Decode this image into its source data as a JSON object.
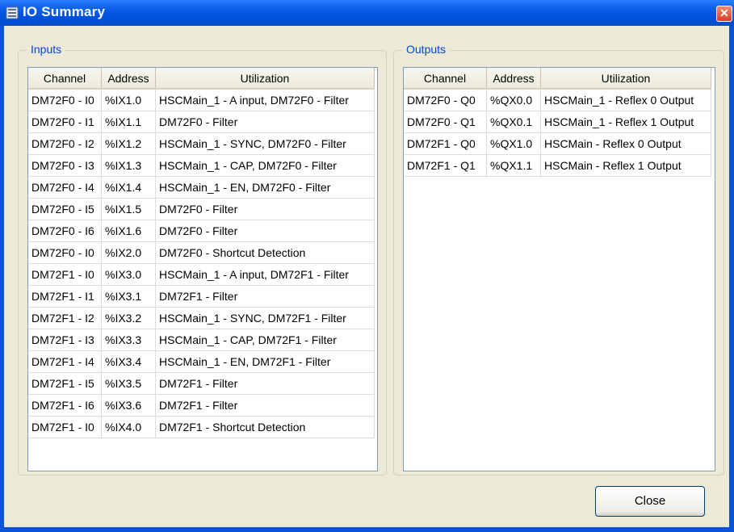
{
  "window": {
    "title": "IO Summary",
    "close_glyph": "✕"
  },
  "columns": {
    "channel": "Channel",
    "address": "Address",
    "utilization": "Utilization"
  },
  "inputs": {
    "legend": "Inputs",
    "rows": [
      {
        "channel": "DM72F0 - I0",
        "address": "%IX1.0",
        "utilization": "HSCMain_1 - A input, DM72F0 - Filter"
      },
      {
        "channel": "DM72F0 - I1",
        "address": "%IX1.1",
        "utilization": "DM72F0 - Filter"
      },
      {
        "channel": "DM72F0 - I2",
        "address": "%IX1.2",
        "utilization": "HSCMain_1 - SYNC, DM72F0 - Filter"
      },
      {
        "channel": "DM72F0 - I3",
        "address": "%IX1.3",
        "utilization": "HSCMain_1 - CAP, DM72F0 - Filter"
      },
      {
        "channel": "DM72F0 - I4",
        "address": "%IX1.4",
        "utilization": "HSCMain_1 - EN, DM72F0 - Filter"
      },
      {
        "channel": "DM72F0 - I5",
        "address": "%IX1.5",
        "utilization": "DM72F0 - Filter"
      },
      {
        "channel": "DM72F0 - I6",
        "address": "%IX1.6",
        "utilization": "DM72F0 - Filter"
      },
      {
        "channel": "DM72F0 - I0",
        "address": "%IX2.0",
        "utilization": "DM72F0 - Shortcut Detection"
      },
      {
        "channel": "DM72F1 - I0",
        "address": "%IX3.0",
        "utilization": "HSCMain_1 - A input, DM72F1 - Filter"
      },
      {
        "channel": "DM72F1 - I1",
        "address": "%IX3.1",
        "utilization": "DM72F1 - Filter"
      },
      {
        "channel": "DM72F1 - I2",
        "address": "%IX3.2",
        "utilization": "HSCMain_1 - SYNC, DM72F1 - Filter"
      },
      {
        "channel": "DM72F1 - I3",
        "address": "%IX3.3",
        "utilization": "HSCMain_1 - CAP, DM72F1 - Filter"
      },
      {
        "channel": "DM72F1 - I4",
        "address": "%IX3.4",
        "utilization": "HSCMain_1 - EN, DM72F1 - Filter"
      },
      {
        "channel": "DM72F1 - I5",
        "address": "%IX3.5",
        "utilization": "DM72F1 - Filter"
      },
      {
        "channel": "DM72F1 - I6",
        "address": "%IX3.6",
        "utilization": "DM72F1 - Filter"
      },
      {
        "channel": "DM72F1 - I0",
        "address": "%IX4.0",
        "utilization": "DM72F1 - Shortcut Detection"
      }
    ]
  },
  "outputs": {
    "legend": "Outputs",
    "rows": [
      {
        "channel": "DM72F0 - Q0",
        "address": "%QX0.0",
        "utilization": "HSCMain_1 -  Reflex 0 Output"
      },
      {
        "channel": "DM72F0 - Q1",
        "address": "%QX0.1",
        "utilization": "HSCMain_1 -  Reflex 1 Output"
      },
      {
        "channel": "DM72F1 - Q0",
        "address": "%QX1.0",
        "utilization": "HSCMain  -  Reflex 0 Output"
      },
      {
        "channel": "DM72F1 - Q1",
        "address": "%QX1.1",
        "utilization": "HSCMain  -  Reflex 1 Output"
      }
    ]
  },
  "buttons": {
    "close": "Close"
  },
  "colors": {
    "title_bar": "#0a5ee8",
    "legend_text": "#0046d5",
    "dialog_bg": "#ece9d8",
    "close_x": "#d6402a"
  },
  "icons": {
    "window": "window-list-icon",
    "close": "close-icon"
  }
}
